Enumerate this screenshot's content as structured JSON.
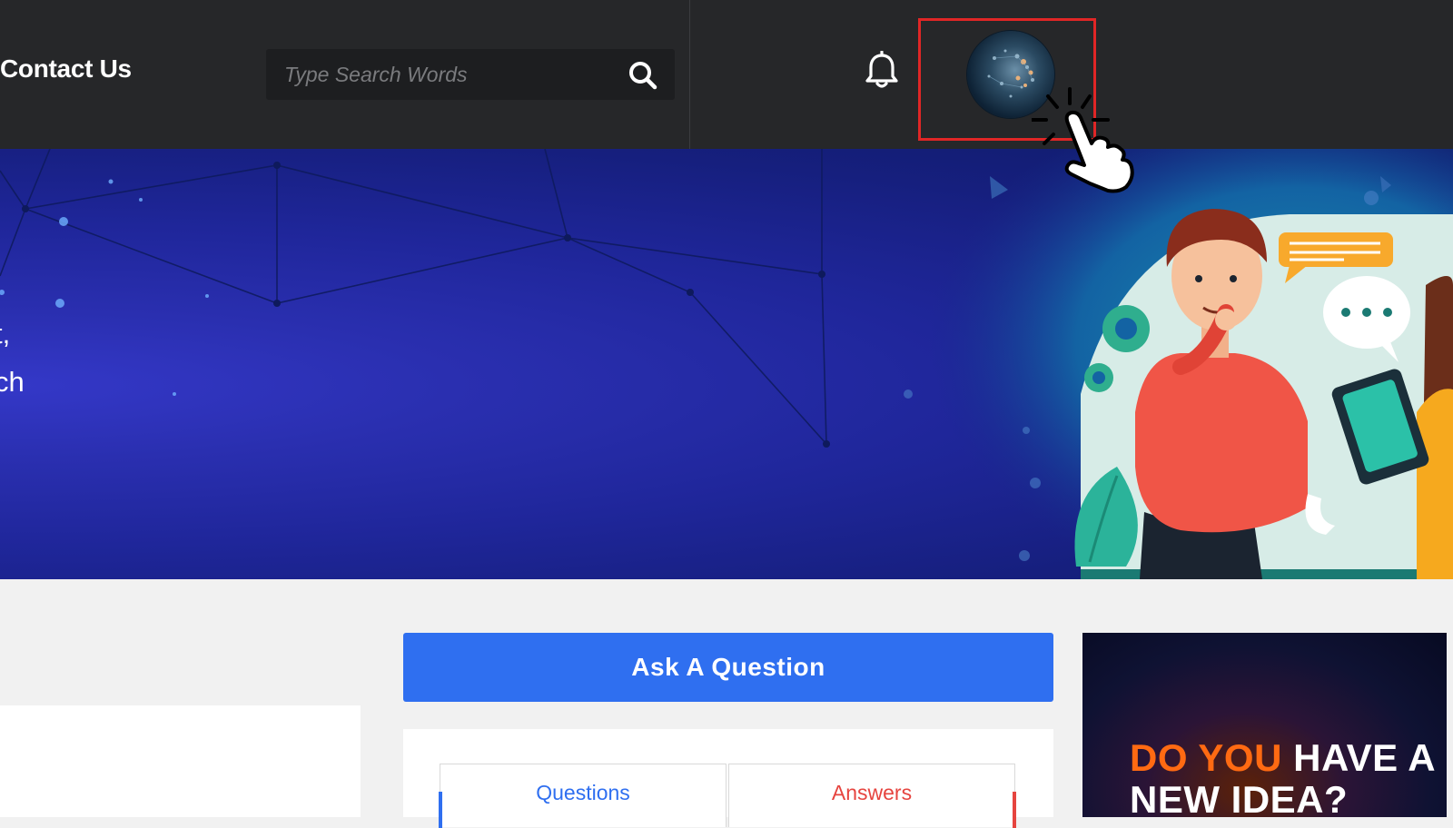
{
  "header": {
    "nav_contact": "Contact Us",
    "search": {
      "placeholder": "Type Search Words"
    }
  },
  "hero": {
    "line1": "t,",
    "line2": "ch"
  },
  "main": {
    "ask_button": "Ask A Question",
    "tabs": [
      {
        "label": "Questions",
        "color": "#2f6ff0"
      },
      {
        "label": "Answers",
        "color": "#e6443f"
      }
    ]
  },
  "ad": {
    "headline_part1": "DO YOU",
    "headline_part2": " HAVE A",
    "headline_line2": "NEW IDEA?"
  },
  "colors": {
    "header_bg": "#262729",
    "accent_blue": "#2f6ff0",
    "accent_red": "#e6443f",
    "highlight_red": "#e02626"
  },
  "icons": [
    "search-icon",
    "bell-icon",
    "avatar",
    "pointer-hand-cursor"
  ]
}
